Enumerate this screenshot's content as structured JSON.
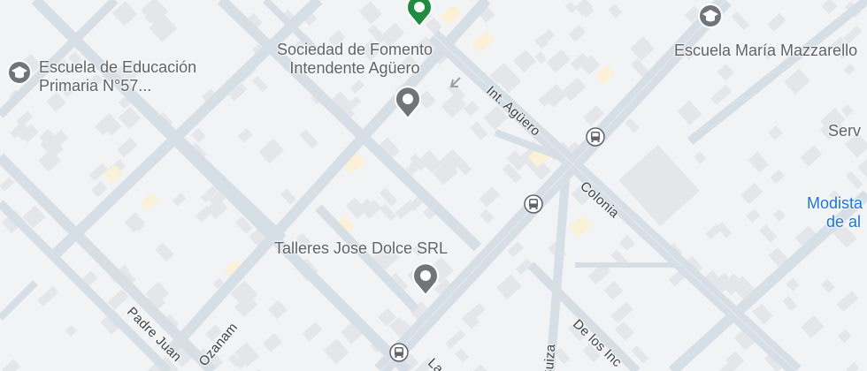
{
  "map": {
    "colors": {
      "background": "#f1f3f4",
      "road": "#d6dee6",
      "road_edge": "#c9d3dc",
      "building": "#e3e5e8",
      "highlight_block": "#fbf3dc",
      "poi_grey": "#70757a",
      "poi_green": "#1e8e3e",
      "text_grey": "#5f6368",
      "text_blue": "#1a73e8",
      "street_text": "#3c4043"
    },
    "pois": [
      {
        "id": "escuela_57",
        "line1": "Escuela de Educación",
        "line2": "Primaria N°57...",
        "icon": "school-icon"
      },
      {
        "id": "escuela_mazzarello",
        "line1": "Escuela María Mazzarello",
        "icon": "school-icon"
      },
      {
        "id": "sociedad",
        "line1": "Sociedad de Fomento",
        "line2": "Intendente Agüero",
        "icon": "place-pin-icon"
      },
      {
        "id": "talleres",
        "line1": "Talleres Jose Dolce SRL",
        "icon": "place-pin-icon"
      },
      {
        "id": "serv",
        "line1": "Serv"
      },
      {
        "id": "modista",
        "line1": "Modista",
        "line2": "de al"
      },
      {
        "id": "green_pin",
        "icon": "green-pin-icon"
      }
    ],
    "streets": [
      {
        "id": "int_aguero",
        "name": "Int. Agüero"
      },
      {
        "id": "colonia",
        "name": "Colonia"
      },
      {
        "id": "padre_juan",
        "name": "Padre Juan"
      },
      {
        "id": "ozanam",
        "name": "Ozanam"
      },
      {
        "id": "suiza",
        "name": "Suiza"
      },
      {
        "id": "de_los_inc",
        "name": "De los Inc"
      },
      {
        "id": "la",
        "name": "La"
      }
    ],
    "transit_stops": [
      {
        "id": "stop_1",
        "icon": "bus-stop-icon"
      },
      {
        "id": "stop_2",
        "icon": "bus-stop-icon"
      },
      {
        "id": "stop_3",
        "icon": "bus-stop-icon"
      }
    ]
  }
}
